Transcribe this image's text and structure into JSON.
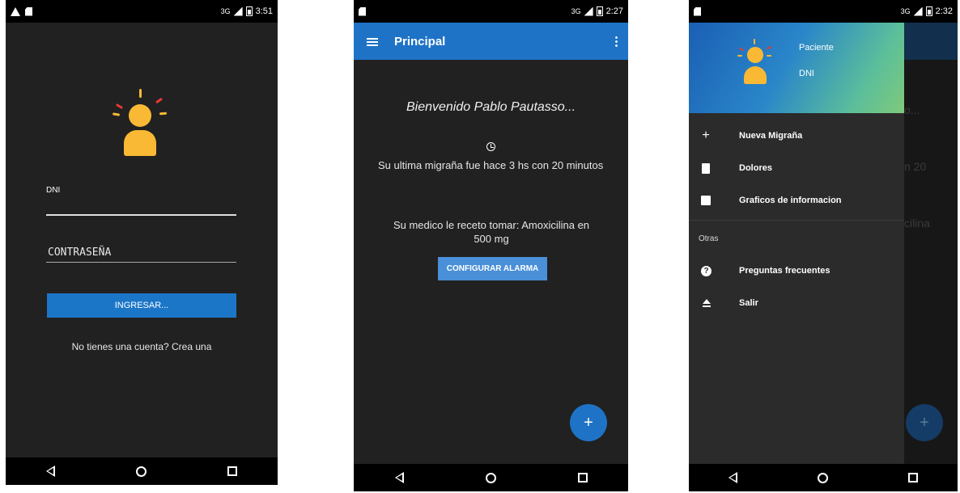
{
  "phone1": {
    "status": {
      "time": "3:51",
      "network": "3G"
    },
    "dni_label": "DNI",
    "password_placeholder": "CONTRASEÑA",
    "login_button": "INGRESAR...",
    "signup_text": "No tienes una cuenta? Crea una"
  },
  "phone2": {
    "status": {
      "time": "2:27",
      "network": "3G"
    },
    "appbar_title": "Principal",
    "welcome": "Bienvenido Pablo Pautasso...",
    "last_migraine": "Su ultima migraña fue hace 3 hs con 20 minutos",
    "prescription": "Su medico le receto tomar: Amoxicilina en 500 mg",
    "alarm_button": "CONFIGURAR ALARMA",
    "fab": "+"
  },
  "phone3": {
    "status": {
      "time": "2:32",
      "network": "3G"
    },
    "header": {
      "name": "Paciente",
      "dni": "DNI"
    },
    "items": [
      {
        "label": "Nueva Migraña",
        "icon": "plus-icon"
      },
      {
        "label": "Dolores",
        "icon": "clipboard-icon"
      },
      {
        "label": "Graficos de informacion",
        "icon": "chart-icon"
      }
    ],
    "section": "Otras",
    "other_items": [
      {
        "label": "Preguntas frecuentes",
        "icon": "help-icon"
      },
      {
        "label": "Salir",
        "icon": "eject-icon"
      }
    ],
    "fab": "+",
    "behind": {
      "t1": "o...",
      "t2": "n 20",
      "t3": "cilina"
    }
  },
  "colors": {
    "primary": "#1e73c6",
    "background": "#212121",
    "accent": "#f9b934"
  }
}
